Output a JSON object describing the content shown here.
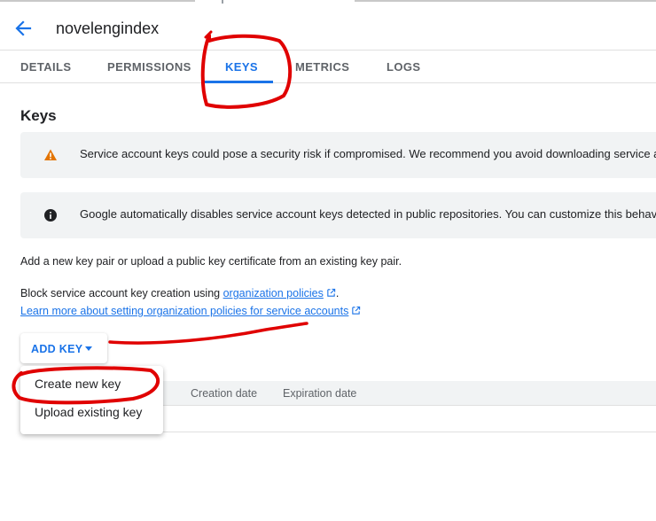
{
  "header": {
    "title": "novelengindex"
  },
  "tabs": [
    {
      "label": "DETAILS"
    },
    {
      "label": "PERMISSIONS"
    },
    {
      "label": "KEYS"
    },
    {
      "label": "METRICS"
    },
    {
      "label": "LOGS"
    }
  ],
  "active_tab": "KEYS",
  "section_title": "Keys",
  "banners": [
    {
      "icon": "warning-icon",
      "text": "Service account keys could pose a security risk if compromised. We recommend you avoid downloading service a"
    },
    {
      "icon": "info-icon",
      "text": "Google automatically disables service account keys detected in public repositories. You can customize this behav"
    }
  ],
  "intro_text": "Add a new key pair or upload a public key certificate from an existing key pair.",
  "policy": {
    "prefix": "Block service account key creation using ",
    "link": "organization policies",
    "suffix": "."
  },
  "learn_more": "Learn more about setting organization policies for service accounts",
  "add_key": {
    "label": "ADD KEY"
  },
  "table": {
    "columns": [
      "Creation date",
      "Expiration date"
    ]
  },
  "menu": {
    "items": [
      "Create new key",
      "Upload existing key"
    ]
  },
  "colors": {
    "accent": "#1a73e8",
    "warning": "#e37400",
    "annotation": "#e00000"
  }
}
